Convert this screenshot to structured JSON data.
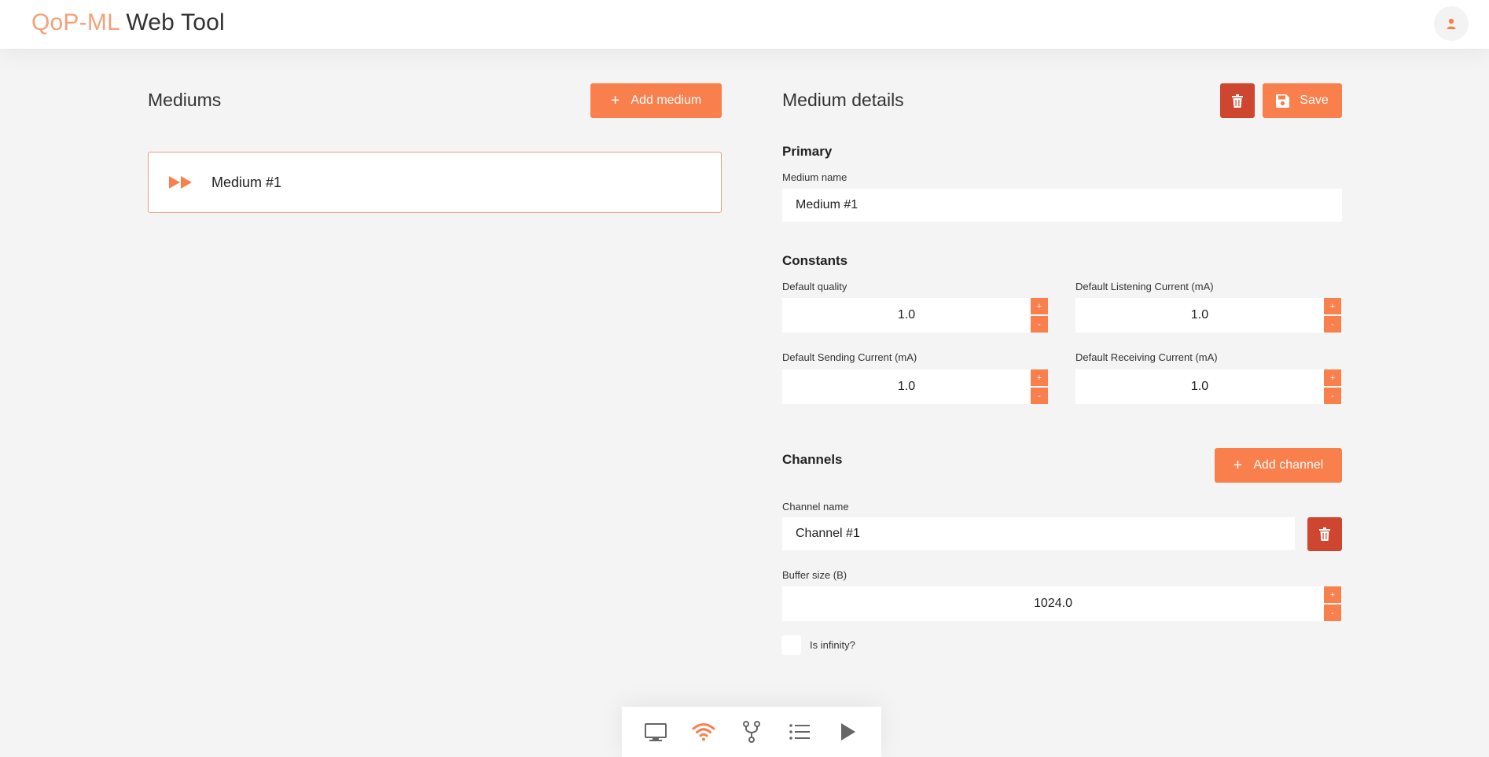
{
  "header": {
    "brand_accent": "QoP-ML",
    "brand_rest": " Web Tool",
    "user_icon": "user-icon"
  },
  "mediums": {
    "title": "Mediums",
    "add_button_label": "Add medium",
    "items": [
      {
        "label": "Medium #1",
        "icon": "fast-forward-icon"
      }
    ]
  },
  "details": {
    "title": "Medium details",
    "save_label": "Save",
    "primary": {
      "heading": "Primary",
      "name_label": "Medium name",
      "name_value": "Medium #1"
    },
    "constants": {
      "heading": "Constants",
      "default_quality_label": "Default quality",
      "default_quality_value": "1.0",
      "listening_label": "Default Listening Current (mA)",
      "listening_value": "1.0",
      "sending_label": "Default Sending Current (mA)",
      "sending_value": "1.0",
      "receiving_label": "Default Receiving Current (mA)",
      "receiving_value": "1.0",
      "stepper_up": "+",
      "stepper_down": "-"
    },
    "channels": {
      "heading": "Channels",
      "add_button_label": "Add channel",
      "channel_name_label": "Channel name",
      "channel_name_value": "Channel #1",
      "buffer_label": "Buffer size (B)",
      "buffer_value": "1024.0",
      "infinity_label": "Is infinity?",
      "infinity_checked": false
    }
  },
  "toolbar": {
    "items": [
      "monitor-icon",
      "wifi-icon",
      "fork-icon",
      "list-icon",
      "play-icon"
    ],
    "active": "wifi-icon"
  },
  "colors": {
    "accent": "#f97f4c",
    "brand_accent": "#f4a07a",
    "danger": "#cf4630",
    "background": "#f4f4f4"
  }
}
